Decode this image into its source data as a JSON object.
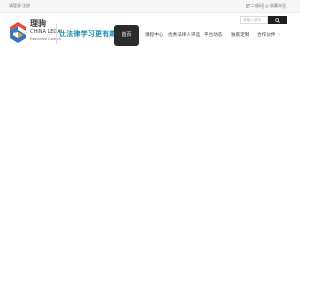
{
  "topbar": {
    "login_label": "请登录",
    "register_label": "注册",
    "qr_label": "二维码",
    "favorites_label": "收藏本站"
  },
  "brand": {
    "name_cn": "理驹",
    "name_en_line1": "CHINA LEGAL",
    "name_en_line2": "Executive Council",
    "slogan": "让法律学习更有趣",
    "logo_colors": [
      "#e8483b",
      "#2f77c0",
      "#e39a2c"
    ]
  },
  "search": {
    "placeholder": "请输入搜索",
    "button_icon": "search-icon"
  },
  "nav": {
    "items": [
      {
        "label": "首页",
        "active": true
      },
      {
        "label": "课程中心"
      },
      {
        "label": "优秀法律人评选"
      },
      {
        "label": "平台动态"
      },
      {
        "label": "独家定制"
      },
      {
        "label": "合作伙伴"
      }
    ],
    "more_icon": "chevron-right-icon"
  },
  "colors": {
    "accent_dark": "#2b2b2b",
    "slogan": "#1a8fb5"
  }
}
